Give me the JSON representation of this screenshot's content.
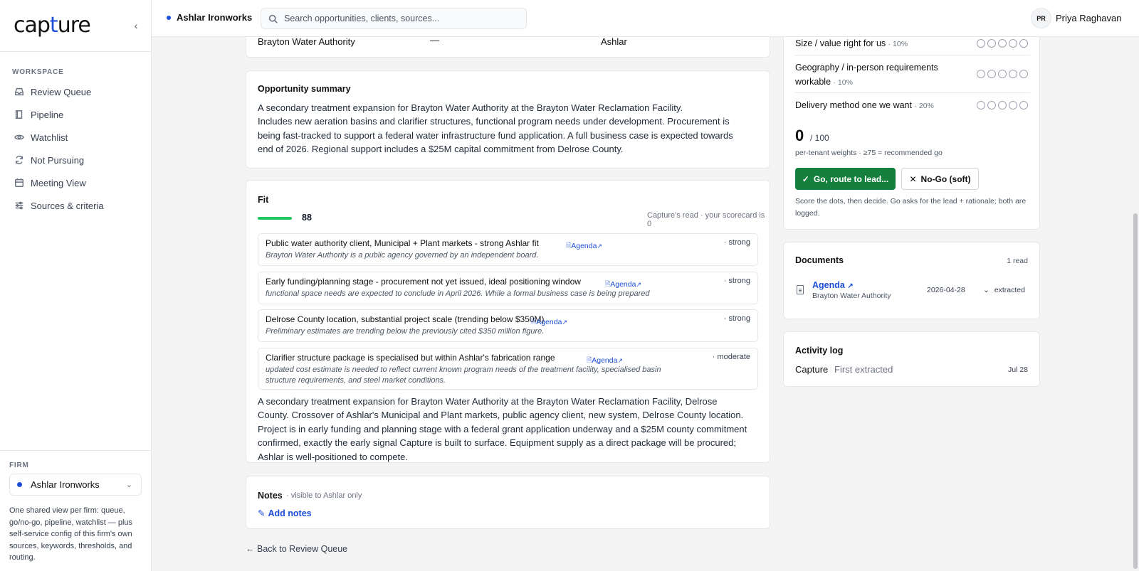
{
  "app": {
    "logo_prefix": "cap",
    "logo_accent": "t",
    "logo_suffix": "ure"
  },
  "sidebar": {
    "section_label": "WORKSPACE",
    "items": [
      {
        "label": "Review Queue",
        "icon": "inbox-icon"
      },
      {
        "label": "Pipeline",
        "icon": "book-icon"
      },
      {
        "label": "Watchlist",
        "icon": "eye-icon"
      },
      {
        "label": "Not Pursuing",
        "icon": "refresh-icon"
      },
      {
        "label": "Meeting View",
        "icon": "calendar-icon"
      },
      {
        "label": "Sources & criteria",
        "icon": "sliders-icon"
      }
    ],
    "firm_label": "FIRM",
    "firm_value": "Ashlar Ironworks",
    "firm_description": "One shared view per firm: queue, go/no-go, pipeline, watchlist — plus self-service config of this firm's own sources, keywords, thresholds, and routing."
  },
  "topbar": {
    "firm": "Ashlar Ironworks",
    "search_placeholder": "Search opportunities, clients, sources...",
    "user_initials": "PR",
    "user_name": "Priya Raghavan"
  },
  "top_card": {
    "client": "Brayton Water Authority",
    "value": "—",
    "firm": "Ashlar"
  },
  "summary": {
    "title": "Opportunity summary",
    "line1": "A secondary treatment expansion for Brayton Water Authority at the Brayton Water Reclamation Facility.",
    "line2": "Includes new aeration basins and clarifier structures, functional program needs under development. Procurement is being fast-tracked to support a federal water infrastructure fund application. A full business case is expected towards end of 2026. Regional support includes a $25M capital commitment from Delrose County."
  },
  "fit": {
    "title": "Fit",
    "score": "88",
    "score_fraction": 0.88,
    "note": "Capture's read · your scorecard is 0",
    "reasons": [
      {
        "claim": "Public water authority client, Municipal + Plant markets - strong Ashlar fit",
        "source": "Agenda",
        "strength": "· strong",
        "quote": "Brayton Water Authority is a public agency governed by an independent board."
      },
      {
        "claim": "Early funding/planning stage - procurement not yet issued, ideal positioning window",
        "source": "Agenda",
        "strength": "· strong",
        "quote": "functional space needs are expected to conclude in April 2026. While a formal business case is being prepared"
      },
      {
        "claim": "Delrose County location, substantial project scale (trending below $350M)",
        "source": "Agenda",
        "strength": "· strong",
        "quote": "Preliminary estimates are trending below the previously cited $350 million figure."
      },
      {
        "claim": "Clarifier structure package is specialised but within Ashlar's fabrication range",
        "source": "Agenda",
        "strength": "· moderate",
        "quote": "updated cost estimate is needed to reflect current known program needs of the treatment facility, specialised basin structure requirements, and steel market conditions."
      }
    ],
    "narrative": "A secondary treatment expansion for Brayton Water Authority at the Brayton Water Reclamation Facility, Delrose County. Crossover of Ashlar's Municipal and Plant markets, public agency client, new system, Delrose County location. Project is in early funding and planning stage with a federal grant application underway and a $25M county commitment confirmed, exactly the early signal Capture is built to surface. Equipment supply as a direct package will be procured; Ashlar is well-positioned to compete."
  },
  "notes": {
    "title": "Notes",
    "visibility": "· visible to Ashlar only",
    "add_label": "Add notes"
  },
  "back_label": "Back to Review Queue",
  "scorecard": {
    "criteria": [
      {
        "label": "Size / value right for us",
        "weight": "· 10%",
        "rating": 0
      },
      {
        "label": "Geography / in-person requirements workable",
        "weight": "· 10%",
        "rating": 0
      },
      {
        "label": "Delivery method one we want",
        "weight": "· 20%",
        "rating": 0
      }
    ],
    "total": "0",
    "out_of": "/ 100",
    "hint": "per-tenant weights · ≥75 = recommended go",
    "go_label": "Go, route to lead...",
    "nogo_label": "No-Go (soft)",
    "footer": "Score the dots, then decide. Go asks for the lead + rationale; both are logged."
  },
  "documents": {
    "title": "Documents",
    "count": "1 read",
    "items": [
      {
        "name": "Agenda",
        "client": "Brayton Water Authority",
        "date": "2026-04-28",
        "status": "extracted"
      }
    ]
  },
  "activity": {
    "title": "Activity log",
    "entries": [
      {
        "actor": "Capture",
        "event": "First extracted",
        "date": "Jul 28"
      }
    ]
  },
  "colors": {
    "accent": "#1d4ed8",
    "go": "#15803d",
    "fit_bar": "#22c55e"
  }
}
